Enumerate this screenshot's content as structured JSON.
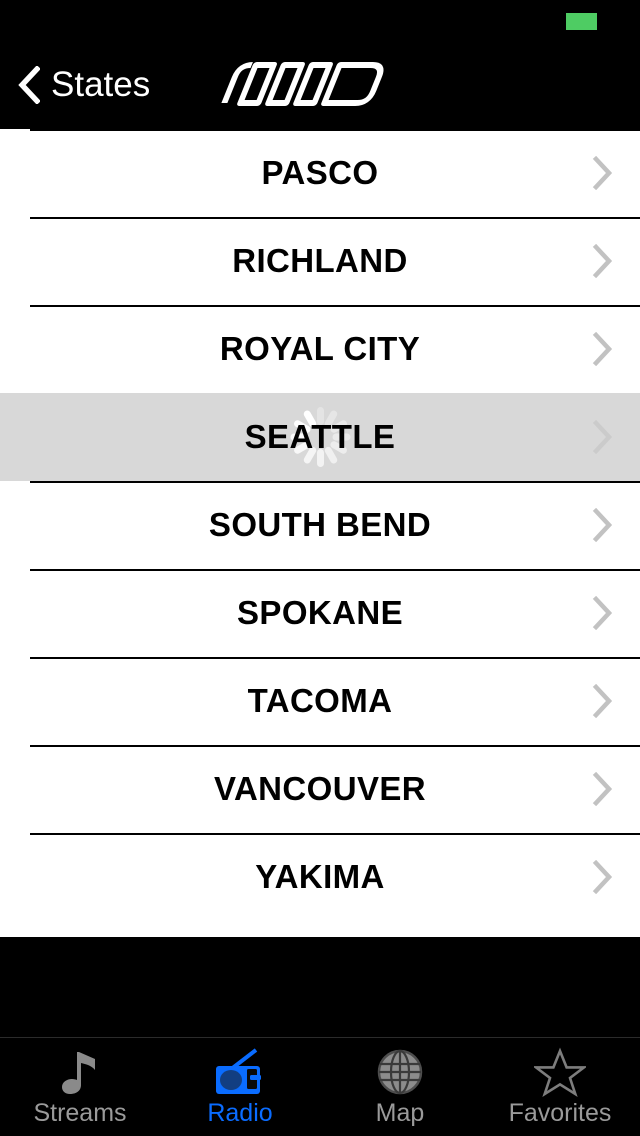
{
  "status_bar": {
    "badge_color": "#4ecc63",
    "badge_name": "green-status-indicator"
  },
  "nav": {
    "back_label": "States",
    "back_icon": "chevron-left-icon",
    "logo_text": "firp",
    "logo_name": "app-logo"
  },
  "list": {
    "chevron_icon": "chevron-right-icon",
    "selected_index": 3,
    "rows": [
      {
        "label": "PASCO",
        "selected": false,
        "loading": false
      },
      {
        "label": "RICHLAND",
        "selected": false,
        "loading": false
      },
      {
        "label": "ROYAL CITY",
        "selected": false,
        "loading": false
      },
      {
        "label": "SEATTLE",
        "selected": true,
        "loading": true
      },
      {
        "label": "SOUTH BEND",
        "selected": false,
        "loading": false
      },
      {
        "label": "SPOKANE",
        "selected": false,
        "loading": false
      },
      {
        "label": "TACOMA",
        "selected": false,
        "loading": false
      },
      {
        "label": "VANCOUVER",
        "selected": false,
        "loading": false
      },
      {
        "label": "YAKIMA",
        "selected": false,
        "loading": false
      }
    ]
  },
  "tab_bar": {
    "active_index": 1,
    "active_color": "#0a6cff",
    "inactive_color": "#9a9a9a",
    "tabs": [
      {
        "label": "Streams",
        "icon": "music-note-icon",
        "active": false
      },
      {
        "label": "Radio",
        "icon": "radio-icon",
        "active": true
      },
      {
        "label": "Map",
        "icon": "globe-icon",
        "active": false
      },
      {
        "label": "Favorites",
        "icon": "star-outline-icon",
        "active": false
      }
    ]
  }
}
